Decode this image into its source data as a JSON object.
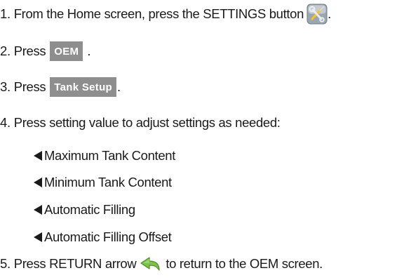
{
  "steps": [
    {
      "num": "1.",
      "text": "From the Home screen, press the SETTINGS button",
      "after": "."
    },
    {
      "num": "2.",
      "text": "Press",
      "button": "OEM",
      "after": "."
    },
    {
      "num": "3.",
      "text": "Press",
      "button": "Tank Setup",
      "after": "."
    },
    {
      "num": "4.",
      "text": "Press setting value to adjust settings as needed:"
    },
    {
      "num": "5.",
      "text": "Press RETURN arrow",
      "after": "to return to the OEM screen."
    }
  ],
  "sub_items": [
    "Maximum Tank Content",
    "Minimum Tank Content",
    "Automatic Filling",
    "Automatic Filling Offset"
  ],
  "icons": {
    "settings": "settings-wrench-screwdriver-icon",
    "return": "return-arrow-icon"
  },
  "colors": {
    "button_bg": "#8e8e8e",
    "button_text": "#ffffff",
    "return_arrow": "#7dc24b",
    "settings_icon_bg": "#9ba7b0"
  }
}
